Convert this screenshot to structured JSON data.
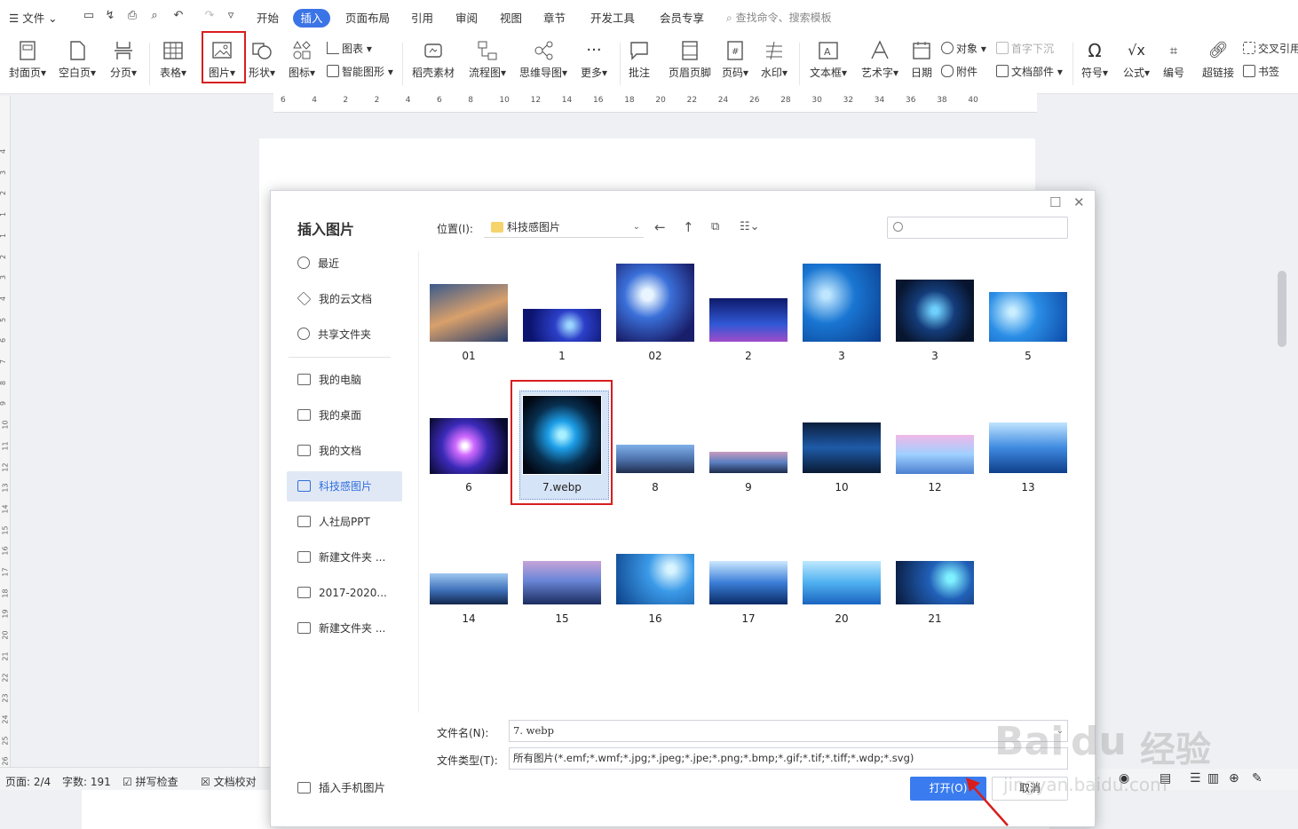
{
  "menubar": {
    "file": "文件",
    "tabs": [
      "开始",
      "插入",
      "页面布局",
      "引用",
      "审阅",
      "视图",
      "章节",
      "开发工具",
      "会员专享"
    ],
    "active_tab": "插入",
    "search_placeholder": "查找命令、搜索模板"
  },
  "ribbon": {
    "buttons": [
      "封面页",
      "空白页",
      "分页",
      "表格",
      "图片",
      "形状",
      "图标",
      "稻壳素材",
      "流程图",
      "思维导图",
      "更多",
      "批注",
      "页眉页脚",
      "页码",
      "水印",
      "文本框",
      "艺术字",
      "日期",
      "符号",
      "公式",
      "编号",
      "超链接"
    ],
    "small": {
      "chart": "图表",
      "smart_art": "智能图形",
      "object": "对象",
      "drop_cap": "首字下沉",
      "attachment": "附件",
      "doc_parts": "文档部件",
      "cross_ref": "交叉引用",
      "bookmark": "书签"
    },
    "highlight_color": "#d81e1e"
  },
  "ruler": {
    "ticks": [
      "6",
      "4",
      "2",
      "2",
      "4",
      "6",
      "8",
      "10",
      "12",
      "14",
      "16",
      "18",
      "20",
      "22",
      "24",
      "26",
      "28",
      "30",
      "32",
      "34",
      "36",
      "38",
      "40"
    ]
  },
  "vruler": {
    "ticks": [
      "4",
      "3",
      "2",
      "1",
      "1",
      "2",
      "3",
      "4",
      "5",
      "6",
      "7",
      "8",
      "9",
      "10",
      "11",
      "12",
      "13",
      "14",
      "15",
      "16",
      "17",
      "18",
      "19",
      "20",
      "21",
      "22",
      "23",
      "24",
      "25",
      "26"
    ]
  },
  "status": {
    "page": "页面: 2/4",
    "words": "字数: 191",
    "spell": "拼写检查",
    "proof": "文档校对"
  },
  "dialog": {
    "title": "插入图片",
    "sidebar": [
      {
        "label": "最近",
        "icon": "clock-icon"
      },
      {
        "label": "我的云文档",
        "icon": "cloud-doc-icon"
      },
      {
        "label": "共享文件夹",
        "icon": "share-folder-icon"
      },
      {
        "label": "我的电脑",
        "icon": "computer-icon"
      },
      {
        "label": "我的桌面",
        "icon": "desktop-icon"
      },
      {
        "label": "我的文档",
        "icon": "folder-icon"
      },
      {
        "label": "科技感图片",
        "icon": "folder-icon"
      },
      {
        "label": "人社局PPT",
        "icon": "folder-icon"
      },
      {
        "label": "新建文件夹 ...",
        "icon": "folder-icon"
      },
      {
        "label": "2017-2020...",
        "icon": "folder-icon"
      },
      {
        "label": "新建文件夹 ...",
        "icon": "folder-icon"
      }
    ],
    "selected_sidebar": "科技感图片",
    "location_label": "位置(I):",
    "location_value": "科技感图片",
    "files": [
      "01",
      "1",
      "02",
      "2",
      "3",
      "3",
      "5",
      "6",
      "7.webp",
      "8",
      "9",
      "10",
      "12",
      "13",
      "14",
      "15",
      "16",
      "17",
      "20",
      "21"
    ],
    "selected_file": "7.webp",
    "filename_label": "文件名(N):",
    "filename_value": "7. webp",
    "filetype_label": "文件类型(T):",
    "filetype_value": "所有图片(*.emf;*.wmf;*.jpg;*.jpeg;*.jpe;*.png;*.bmp;*.gif;*.tif;*.tiff;*.wdp;*.svg)",
    "open_button": "打开(O)",
    "cancel_button": "取消",
    "mobile_button": "插入手机图片"
  },
  "watermark": {
    "brand": "Bai",
    "paw": "du",
    "cn": "经验",
    "url": "jingyan.baidu.com"
  }
}
